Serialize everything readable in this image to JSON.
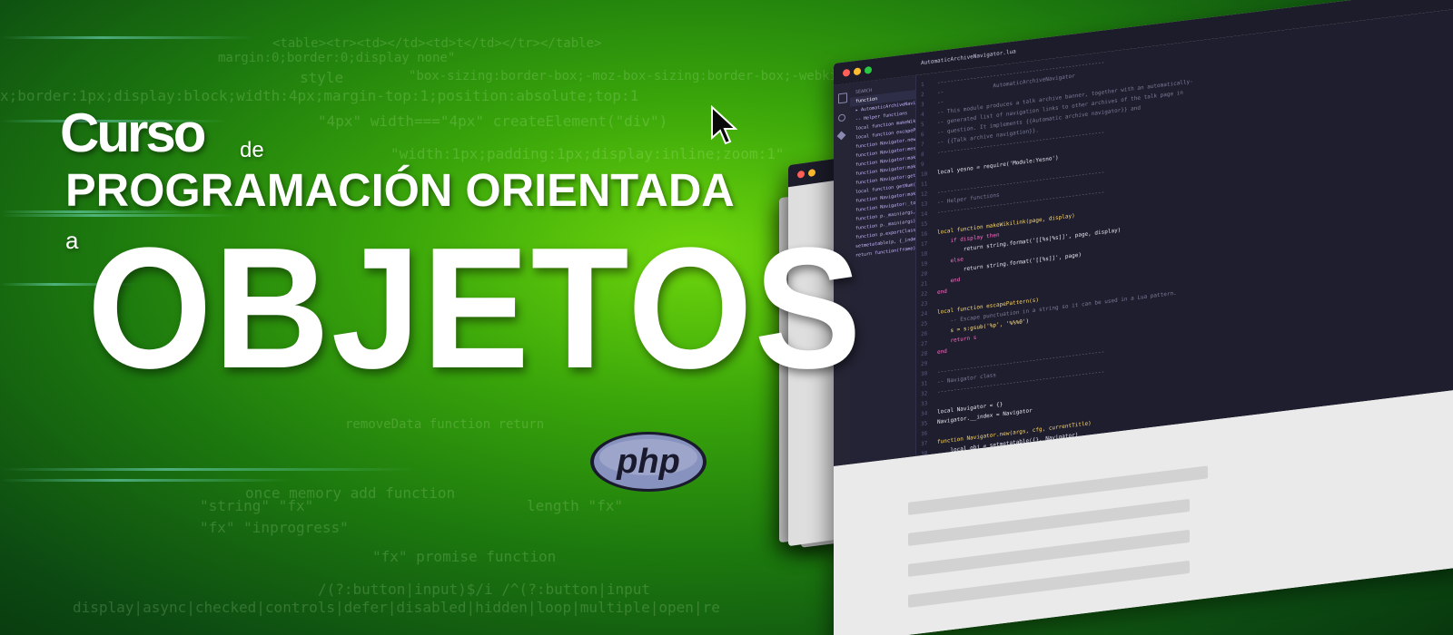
{
  "title": {
    "curso": "Curso",
    "de": "de",
    "programacion": "PROGRAMACIÓN ORIENTADA",
    "a": "a",
    "objetos": "OBJETOS"
  },
  "logo": {
    "text": "php",
    "fill": "#8892bf",
    "dark": "#1a1a2e"
  },
  "background": {
    "code_fragments": [
      "<table><tr><td></td><td>t</td></tr></table>",
      "margin:0;border:0;display none\"",
      "style",
      "\"box-sizing:border-box;-moz-box-sizing:border-box;-webkit-box-sizing:border-box\"",
      "x;border:1px;display:block;width:4px;margin-top:1;position:absolute;top:1",
      "\"4px\"   width===\"4px\"    createElement(\"div\")",
      "\"width:1px;padding:1px;display:inline;zoom:1\"",
      "removeData function  return",
      "\"string\"   \"fx\"",
      "\"fx\"   \"inprogress\"",
      "\"fx\"   promise function",
      "length  \"fx\"",
      "once memory  add function",
      "/(?:button|input)$/i   /^(?:button|input",
      "display|async|checked|controls|defer|disabled|hidden|loop|multiple|open|re"
    ]
  },
  "editor": {
    "tab_title": "AutomaticArchiveNavigator.lua",
    "sidebar_items": [
      "SEARCH",
      "function",
      "▸ AutomaticArchiveNavig...",
      "-- Helper functions",
      "local function makeWikiLink(p...",
      "local function escapePattern(s)",
      "function Navigator.new(args...",
      "function Navigator:messageG...",
      "function Navigator:makeBlurb()",
      "function Navigator:makeMess...",
      "function Navigator:getArchiv...",
      "local function getNum(i, curre...",
      "function Navigator:makeLinkD...",
      "function Navigator:_tostring()",
      "function p._main(args, cfg, curr...",
      "function p._main(args)",
      "function p.exportClasses()",
      "setmetatable(p, {_index = fu...",
      "return function(frame)"
    ],
    "code_lines": [
      {
        "n": "1",
        "t": "---------------------------------------------------",
        "c": "c-com"
      },
      {
        "n": "2",
        "t": "--               AutomaticArchiveNavigator",
        "c": "c-com"
      },
      {
        "n": "3",
        "t": "--",
        "c": "c-com"
      },
      {
        "n": "4",
        "t": "-- This module produces a talk archive banner, together with an automatically-",
        "c": "c-com"
      },
      {
        "n": "5",
        "t": "-- generated list of navigation links to other archives of the talk page in",
        "c": "c-com"
      },
      {
        "n": "6",
        "t": "-- question. It implements {{Automatic archive navigator}} and",
        "c": "c-com"
      },
      {
        "n": "7",
        "t": "-- {{Talk archive navigation}}.",
        "c": "c-com"
      },
      {
        "n": "8",
        "t": "---------------------------------------------------",
        "c": "c-com"
      },
      {
        "n": "9",
        "t": "",
        "c": ""
      },
      {
        "n": "10",
        "t": "local yesno = require('Module:Yesno')",
        "c": ""
      },
      {
        "n": "11",
        "t": "",
        "c": ""
      },
      {
        "n": "12",
        "t": "---------------------------------------------------",
        "c": "c-com"
      },
      {
        "n": "13",
        "t": "-- Helper functions",
        "c": "c-com"
      },
      {
        "n": "14",
        "t": "---------------------------------------------------",
        "c": "c-com"
      },
      {
        "n": "15",
        "t": "",
        "c": ""
      },
      {
        "n": "16",
        "t": "local function makeWikilink(page, display)",
        "c": "c-fn"
      },
      {
        "n": "17",
        "t": "    if display then",
        "c": "c-kw"
      },
      {
        "n": "18",
        "t": "        return string.format('[[%s|%s]]', page, display)",
        "c": ""
      },
      {
        "n": "19",
        "t": "    else",
        "c": "c-kw"
      },
      {
        "n": "20",
        "t": "        return string.format('[[%s]]', page)",
        "c": ""
      },
      {
        "n": "21",
        "t": "    end",
        "c": "c-kw"
      },
      {
        "n": "22",
        "t": "end",
        "c": "c-kw"
      },
      {
        "n": "23",
        "t": "",
        "c": ""
      },
      {
        "n": "24",
        "t": "local function escapePattern(s)",
        "c": "c-fn"
      },
      {
        "n": "25",
        "t": "    -- Escape punctuation in a string so it can be used in a Lua pattern.",
        "c": "c-com"
      },
      {
        "n": "26",
        "t": "    s = s:gsub('%p', '%%%0')",
        "c": "c-str"
      },
      {
        "n": "27",
        "t": "    return s",
        "c": "c-kw"
      },
      {
        "n": "28",
        "t": "end",
        "c": "c-kw"
      },
      {
        "n": "29",
        "t": "",
        "c": ""
      },
      {
        "n": "30",
        "t": "---------------------------------------------------",
        "c": "c-com"
      },
      {
        "n": "31",
        "t": "-- Navigator class",
        "c": "c-com"
      },
      {
        "n": "32",
        "t": "---------------------------------------------------",
        "c": "c-com"
      },
      {
        "n": "33",
        "t": "",
        "c": ""
      },
      {
        "n": "34",
        "t": "local Navigator = {}",
        "c": ""
      },
      {
        "n": "35",
        "t": "Navigator.__index = Navigator",
        "c": ""
      },
      {
        "n": "36",
        "t": "",
        "c": ""
      },
      {
        "n": "37",
        "t": "function Navigator.new(args, cfg, currentTitle)",
        "c": "c-fn"
      },
      {
        "n": "38",
        "t": "    local obj = setmetatable({}, Navigator)",
        "c": ""
      }
    ]
  }
}
